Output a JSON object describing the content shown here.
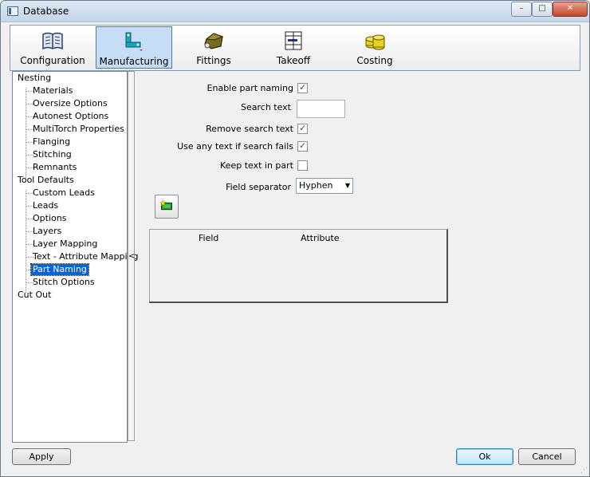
{
  "window": {
    "title": "Database",
    "controls": {
      "minimize": "–",
      "maximize": "□",
      "close": "✕"
    }
  },
  "tabs": [
    {
      "label": "Configuration",
      "icon": "book-icon",
      "active": false
    },
    {
      "label": "Manufacturing",
      "icon": "machine-icon",
      "active": true
    },
    {
      "label": "Fittings",
      "icon": "fitting-icon",
      "active": false
    },
    {
      "label": "Takeoff",
      "icon": "takeoff-icon",
      "active": false
    },
    {
      "label": "Costing",
      "icon": "coins-icon",
      "active": false
    }
  ],
  "tree": {
    "items": [
      {
        "label": "Nesting",
        "level": 0
      },
      {
        "label": "Materials",
        "level": 1
      },
      {
        "label": "Oversize Options",
        "level": 1
      },
      {
        "label": "Autonest Options",
        "level": 1
      },
      {
        "label": "MultiTorch Properties",
        "level": 1
      },
      {
        "label": "Flanging",
        "level": 1
      },
      {
        "label": "Stitching",
        "level": 1
      },
      {
        "label": "Remnants",
        "level": 1
      },
      {
        "label": "Tool Defaults",
        "level": 0
      },
      {
        "label": "Custom Leads",
        "level": 1
      },
      {
        "label": "Leads",
        "level": 1
      },
      {
        "label": "Options",
        "level": 1
      },
      {
        "label": "Layers",
        "level": 1
      },
      {
        "label": "Layer Mapping",
        "level": 1
      },
      {
        "label": "Text - Attribute Mapping",
        "level": 1
      },
      {
        "label": "Part Naming",
        "level": 1,
        "selected": true
      },
      {
        "label": "Stitch Options",
        "level": 1
      },
      {
        "label": "Cut Out",
        "level": 0
      }
    ]
  },
  "splitter": {
    "arrow": "<"
  },
  "form": {
    "enable_part_naming": {
      "label": "Enable part naming",
      "checked": true
    },
    "search_text": {
      "label": "Search text",
      "value": ""
    },
    "remove_search_text": {
      "label": "Remove search text",
      "checked": true
    },
    "use_any_text": {
      "label": "Use any text if search fails",
      "checked": true
    },
    "keep_text": {
      "label": "Keep text in part",
      "checked": false
    },
    "field_separator": {
      "label": "Field separator",
      "value": "Hyphen"
    }
  },
  "grid": {
    "columns": [
      "Field",
      "Attribute"
    ],
    "rows": []
  },
  "buttons": {
    "apply": "Apply",
    "ok": "Ok",
    "cancel": "Cancel"
  }
}
